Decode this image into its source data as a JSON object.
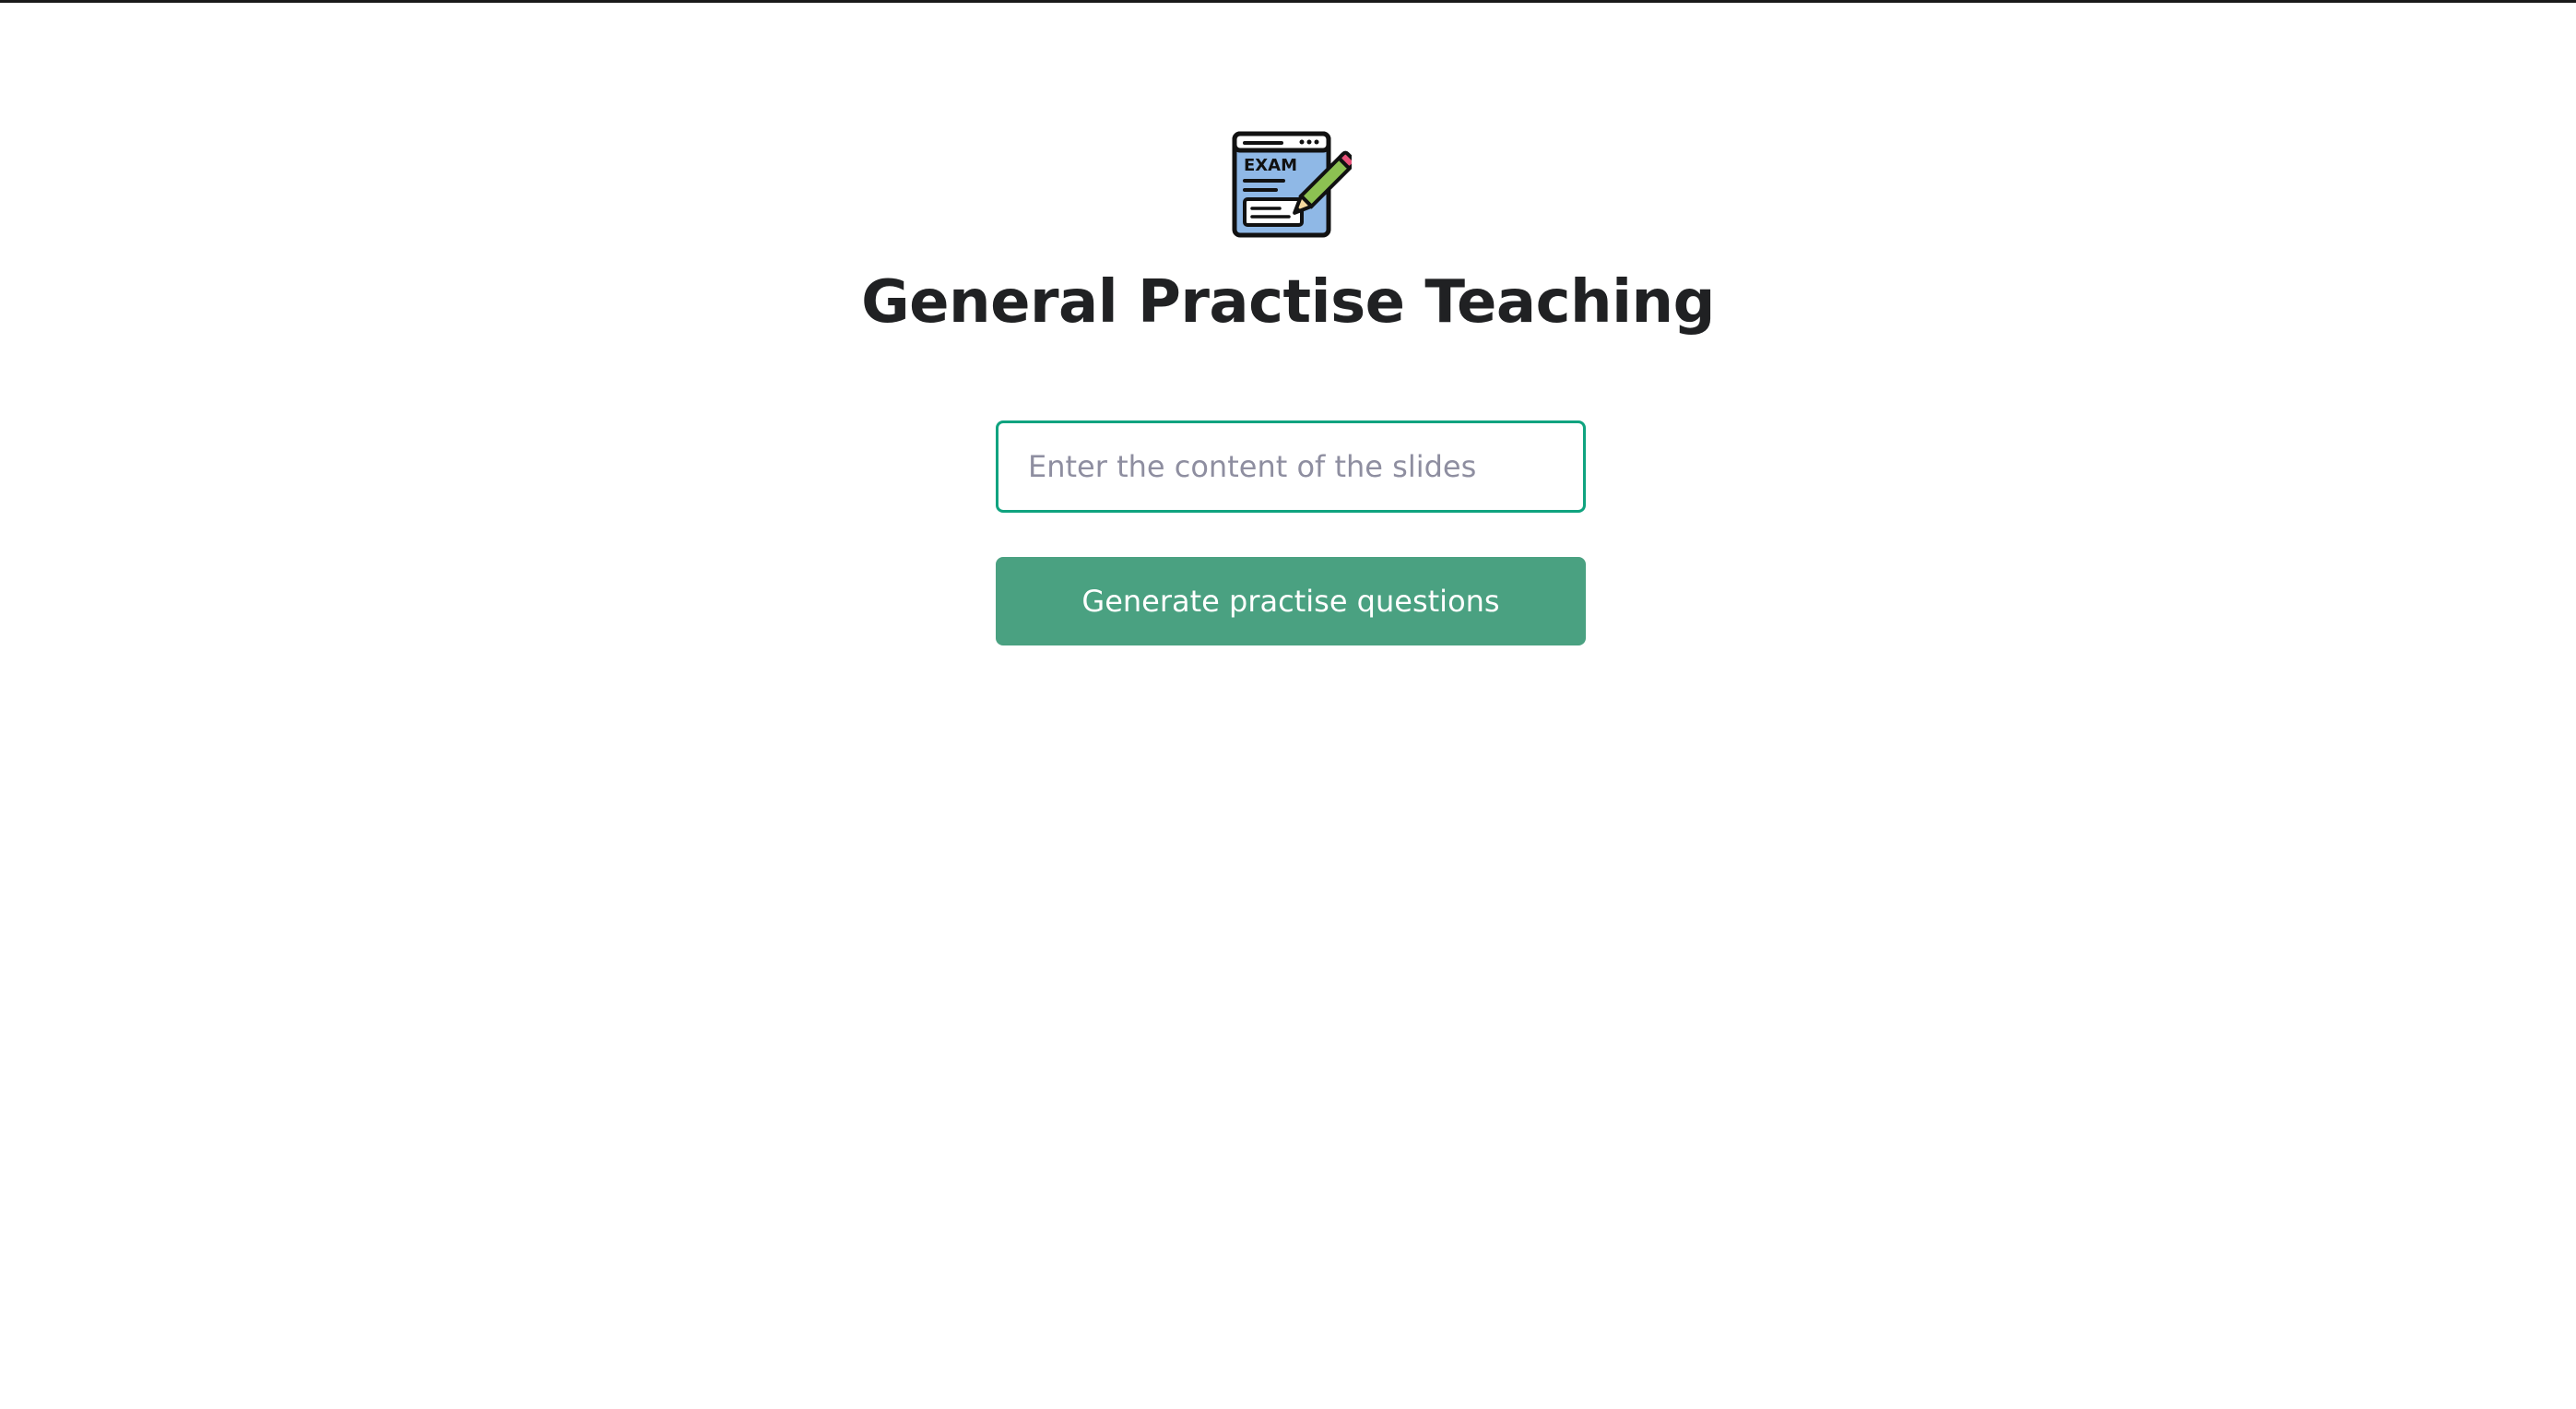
{
  "app": {
    "title": "General Practise Teaching",
    "logo_icon": "exam-pencil-icon",
    "logo_text": "EXAM"
  },
  "form": {
    "input_placeholder": "Enter the content of the slides",
    "input_value": "",
    "submit_label": "Generate practise questions"
  },
  "colors": {
    "accent": "#10a37f",
    "button": "#4aa181",
    "title": "#202123",
    "placeholder": "#8e8ea0"
  }
}
